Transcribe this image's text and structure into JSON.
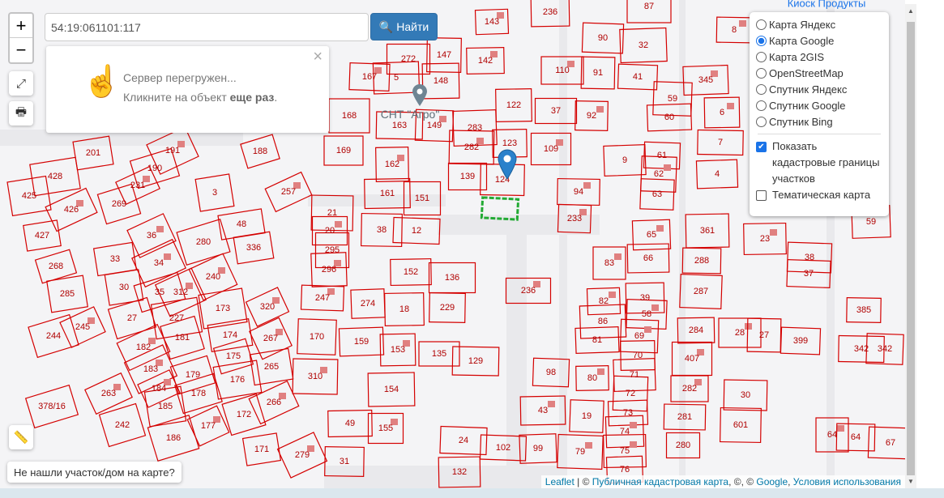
{
  "search": {
    "value": "54:19:061101:117",
    "button": "Найти"
  },
  "zoom": {
    "in": "+",
    "out": "−"
  },
  "popup": {
    "line1": "Сервер перегружен...",
    "line2_prefix": "Кликните на объект ",
    "line2_bold": "еще раз",
    "line2_suffix": ".",
    "close": "×"
  },
  "map": {
    "poi": "СНТ \"Агро\"",
    "top_poi": "Киоск Продукты",
    "parcels": [
      "143",
      "236",
      "87",
      "8",
      "90",
      "32",
      "142",
      "272",
      "147",
      "167",
      "5",
      "148",
      "110",
      "91",
      "41",
      "345",
      "122",
      "37",
      "92",
      "59",
      "60",
      "6",
      "168",
      "163",
      "149",
      "283",
      "123",
      "109",
      "7",
      "201",
      "191",
      "188",
      "169",
      "282",
      "61",
      "9",
      "162",
      "139",
      "124",
      "62",
      "4",
      "428",
      "231",
      "190",
      "3",
      "257",
      "161",
      "151",
      "94",
      "63",
      "425",
      "426",
      "269",
      "21",
      "233",
      "59",
      "48",
      "20",
      "38",
      "12",
      "65",
      "361",
      "427",
      "36",
      "280",
      "336",
      "23",
      "295",
      "33",
      "34",
      "268",
      "66",
      "83",
      "288",
      "38",
      "296",
      "152",
      "136",
      "240",
      "37",
      "30",
      "312",
      "35",
      "285",
      "247",
      "274",
      "18",
      "236",
      "229",
      "287",
      "82",
      "39",
      "173",
      "320",
      "27",
      "227",
      "245",
      "244",
      "385",
      "58",
      "86",
      "284",
      "28",
      "27",
      "399",
      "182",
      "181",
      "174",
      "267",
      "170",
      "159",
      "153",
      "135",
      "129",
      "69",
      "81",
      "70",
      "407",
      "342",
      "342",
      "183",
      "175",
      "265",
      "310",
      "98",
      "71",
      "80",
      "179",
      "176",
      "184",
      "178",
      "154",
      "282",
      "30",
      "72",
      "263",
      "378/16",
      "185",
      "266",
      "19",
      "73",
      "43",
      "172",
      "281",
      "177",
      "242",
      "49",
      "155",
      "601",
      "24",
      "74",
      "186",
      "171",
      "279",
      "102",
      "99",
      "75",
      "280",
      "31",
      "79",
      "76",
      "132",
      "64",
      "64",
      "67"
    ]
  },
  "layers": {
    "options": [
      "Карта Яндекс",
      "Карта Google",
      "Карта 2GIS",
      "OpenStreetMap",
      "Спутник Яндекс",
      "Спутник Google",
      "Спутник Bing"
    ],
    "selected": 1,
    "show_cadastral": "Показать кадастровые границы участков",
    "show_cadastral_checked": true,
    "thematic": "Тематическая карта",
    "thematic_checked": false
  },
  "not_found": "Не нашли участок/дом на карте?",
  "attribution": {
    "leaflet": "Leaflet",
    "sep1": " | © ",
    "pkk": "Публичная кадастровая карта",
    "mid": ", ©, © ",
    "google": "Google",
    "comma": ", ",
    "terms": "Условия использования"
  },
  "colors": {
    "parcel": "#d40000",
    "building": "#e08080",
    "selected": "#22aa33",
    "button": "#337ab7"
  }
}
